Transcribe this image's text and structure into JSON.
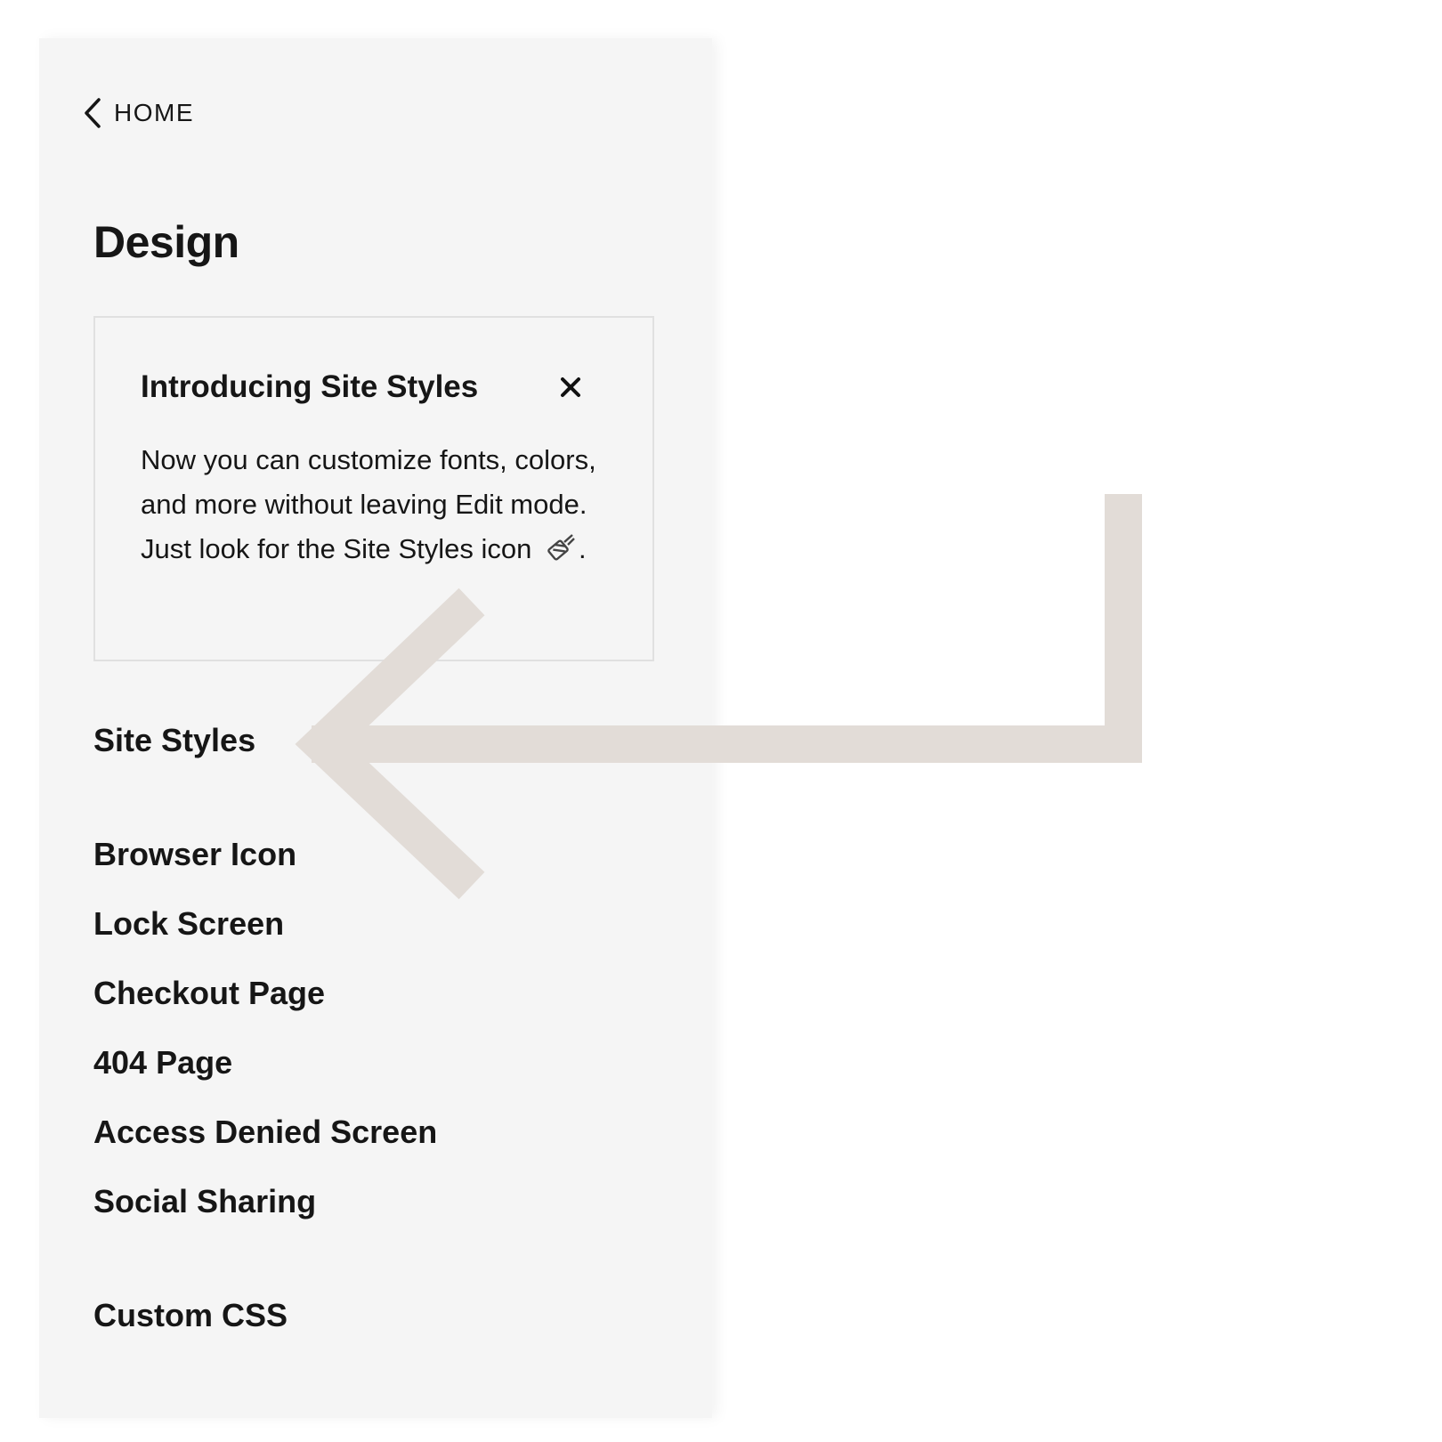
{
  "nav": {
    "back_label": "HOME"
  },
  "page": {
    "title": "Design"
  },
  "callout": {
    "title": "Introducing Site Styles",
    "body_text": "Now you can customize fonts, colors, and more without leaving Edit mode. Just look for the Site Styles icon",
    "body_end": "."
  },
  "menu": {
    "items": [
      {
        "label": "Site Styles"
      },
      {
        "label": "Browser Icon"
      },
      {
        "label": "Lock Screen"
      },
      {
        "label": "Checkout Page"
      },
      {
        "label": "404 Page"
      },
      {
        "label": "Access Denied Screen"
      },
      {
        "label": "Social Sharing"
      },
      {
        "label": "Custom CSS"
      }
    ]
  },
  "colors": {
    "panel_bg": "#f5f5f5",
    "text": "#161616",
    "callout_border": "#e0e0e0",
    "arrow": "#e2dcd7"
  },
  "icons": {
    "back": "chevron-left-icon",
    "close": "close-icon",
    "site_styles": "paintbrush-icon",
    "annotation": "arrow-annotation"
  }
}
